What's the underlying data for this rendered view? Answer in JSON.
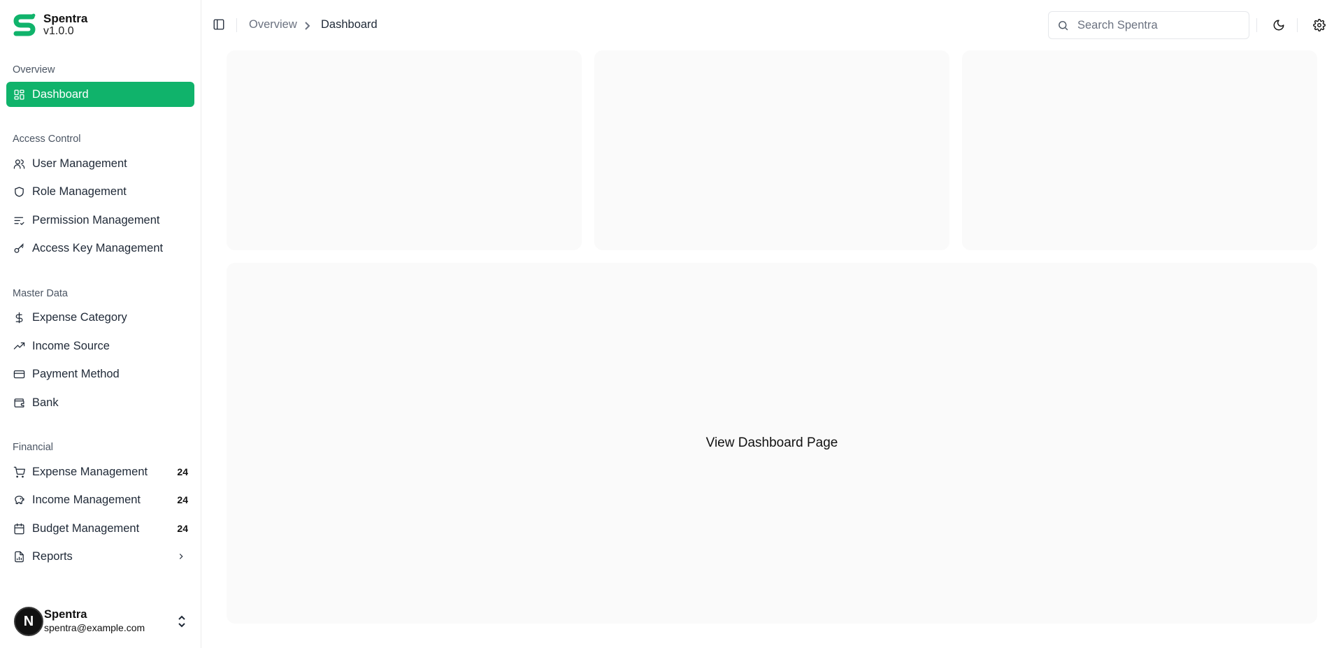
{
  "brand": {
    "name": "Spentra",
    "version": "v1.0.0",
    "color": "#10b36b"
  },
  "sidebar": {
    "groups": {
      "overview": "Overview",
      "access": "Access Control",
      "master": "Master Data",
      "financial": "Financial"
    },
    "items": {
      "dashboard": "Dashboard",
      "user_mgmt": "User Management",
      "role_mgmt": "Role Management",
      "perm_mgmt": "Permission Management",
      "key_mgmt": "Access Key Management",
      "expense_cat": "Expense Category",
      "income_src": "Income Source",
      "payment": "Payment Method",
      "bank": "Bank",
      "expense_mgmt": "Expense Management",
      "income_mgmt": "Income Management",
      "budget_mgmt": "Budget Management",
      "reports": "Reports"
    },
    "badges": {
      "expense_mgmt": "24",
      "income_mgmt": "24",
      "budget_mgmt": "24"
    }
  },
  "user": {
    "initial": "N",
    "name": "Spentra",
    "email": "spentra@example.com"
  },
  "header": {
    "breadcrumb": [
      "Overview",
      "Dashboard"
    ],
    "search_placeholder": "Search Spentra"
  },
  "main": {
    "content_label": "View Dashboard Page"
  }
}
